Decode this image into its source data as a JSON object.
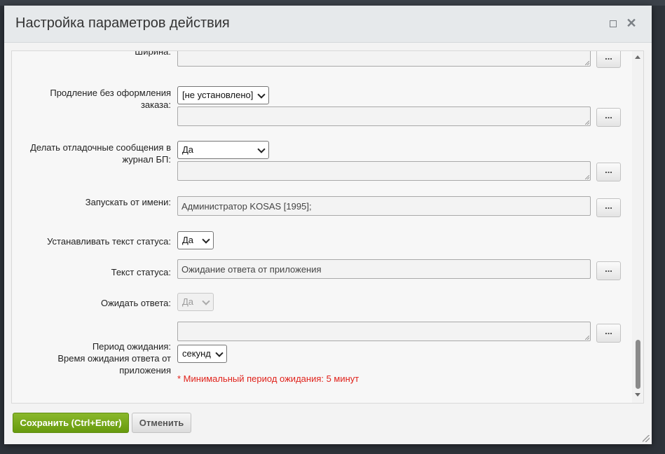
{
  "dialog": {
    "title": "Настройка параметров действия",
    "maximize_icon": "maximize-icon",
    "close_icon": "close-icon"
  },
  "fields": [
    {
      "label": "Ширина:",
      "value": ""
    },
    {
      "label": "Продление без оформления заказа:",
      "select": "[не установлено]",
      "value": ""
    },
    {
      "label": "Делать отладочные сообщения в журнал БП:",
      "select": "Да",
      "value": ""
    },
    {
      "label": "Запускать от имени:",
      "value": "Администратор KOSAS [1995];"
    },
    {
      "label": "Устанавливать текст статуса:",
      "select": "Да"
    },
    {
      "label": "Текст статуса:",
      "value": "Ожидание ответа от приложения"
    },
    {
      "label": "Ожидать ответа:",
      "select": "Да",
      "disabled": true
    },
    {
      "label": "Период ожидания:",
      "value": ""
    },
    {
      "label": "Время ожидания ответа от приложения",
      "select": "секунд"
    }
  ],
  "dots_label": "...",
  "note": "* Минимальный период ожидания: 5 минут",
  "buttons": {
    "save": "Сохранить (Ctrl+Enter)",
    "cancel": "Отменить"
  },
  "colors": {
    "save_button": "#79aa1e",
    "note": "#e0221b"
  }
}
